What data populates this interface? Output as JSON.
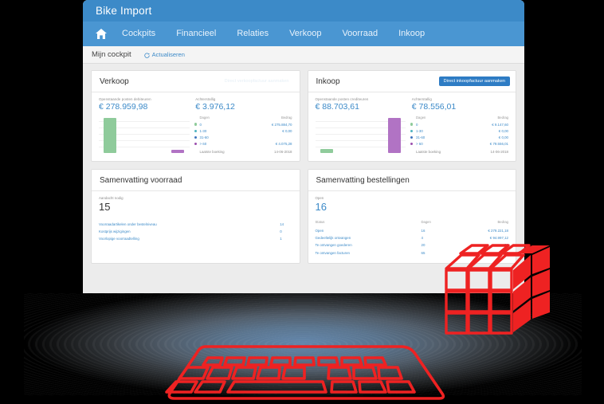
{
  "window": {
    "app_title": "Bike Import",
    "nav": [
      {
        "label": "Cockpits"
      },
      {
        "label": "Financieel"
      },
      {
        "label": "Relaties"
      },
      {
        "label": "Verkoop"
      },
      {
        "label": "Voorraad"
      },
      {
        "label": "Inkoop"
      }
    ],
    "home_icon": "home-icon",
    "subbar": {
      "breadcrumb": "Mijn cockpit",
      "refresh_label": "Actualiseren",
      "refresh_icon": "refresh-icon"
    }
  },
  "colors": {
    "titlebar": "#3c8ac8",
    "navbar": "#4a96d2",
    "accent_blue": "#3c8ac8",
    "button_blue": "#2e7cc4",
    "bar_green": "#8fcb9b",
    "bar_purple": "#b173c4",
    "legend_green": "#8fcb9b",
    "legend_teal": "#4fb3c0",
    "legend_blue": "#3f74bd",
    "legend_purple": "#9b4fae",
    "wireframe_red": "#ee2222"
  },
  "cards": {
    "verkoop": {
      "title": "Verkoop",
      "action_label": "Direct verkoopfactuur aanmaken",
      "kpi_left_label": "Openstaande posten debiteuren",
      "kpi_left_value": "€ 278.959,98",
      "kpi_right_label": "Achterstallig",
      "kpi_right_value": "€ 3.976,12",
      "col_days": "Dagen",
      "col_amount": "Bedrag",
      "rows": [
        {
          "color": "#8fcb9b",
          "days": "0",
          "amount": "€ 275.884,70"
        },
        {
          "color": "#4fb3c0",
          "days": "1-30",
          "amount": "€ 0,00"
        },
        {
          "color": "#3f74bd",
          "days": "31-60",
          "amount": ""
        },
        {
          "color": "#9b4fae",
          "days": "> 60",
          "amount": "€ 4.075,28"
        }
      ],
      "last_label": "Laatste boeking",
      "last_value": "14-06-2018",
      "chart_data": {
        "type": "bar",
        "categories": [
          "0",
          "1-30",
          "31-60",
          "> 60"
        ],
        "values": [
          275884.7,
          0,
          0,
          4075.28
        ],
        "colors": [
          "#8fcb9b",
          "#4fb3c0",
          "#3f74bd",
          "#b173c4"
        ],
        "title": "Verkoop",
        "xlabel": "Dagen",
        "ylabel": "Bedrag",
        "grid": true,
        "legend": "right"
      }
    },
    "inkoop": {
      "title": "Inkoop",
      "action_label": "Direct inkoopfactuur aanmaken",
      "kpi_left_label": "Openstaande posten crediteuren",
      "kpi_left_value": "€ 88.703,61",
      "kpi_right_label": "Achterstallig",
      "kpi_right_value": "€ 78.556,01",
      "col_days": "Dagen",
      "col_amount": "Bedrag",
      "rows": [
        {
          "color": "#8fcb9b",
          "days": "0",
          "amount": "€ 9.147,60"
        },
        {
          "color": "#4fb3c0",
          "days": "1-30",
          "amount": "€ 0,00"
        },
        {
          "color": "#3f74bd",
          "days": "31-60",
          "amount": "€ 0,00"
        },
        {
          "color": "#9b4fae",
          "days": "> 60",
          "amount": "€ 79.556,01"
        }
      ],
      "last_label": "Laatste boeking",
      "last_value": "14-06-2018",
      "chart_data": {
        "type": "bar",
        "categories": [
          "0",
          "1-30",
          "31-60",
          "> 60"
        ],
        "values": [
          9147.6,
          0,
          0,
          79556.01
        ],
        "colors": [
          "#8fcb9b",
          "#4fb3c0",
          "#3f74bd",
          "#b173c4"
        ],
        "title": "Inkoop",
        "xlabel": "Dagen",
        "ylabel": "Bedrag",
        "grid": true,
        "legend": "right"
      }
    },
    "voorraad": {
      "title": "Samenvatting voorraad",
      "summary_label": "Aandacht nodig",
      "summary_value": "15",
      "rows": [
        {
          "label": "Voorraadartikelen onder bestelniveau",
          "value": "14"
        },
        {
          "label": "Kostprijs wijzigingen",
          "value": "0"
        },
        {
          "label": "Voorlopige voorraadtelling",
          "value": "1"
        }
      ]
    },
    "bestellingen": {
      "title": "Samenvatting bestellingen",
      "summary_label": "Open",
      "summary_value": "16",
      "col_status": "Status",
      "col_days": "Dagen",
      "col_amount": "Bedrag",
      "rows": [
        {
          "status": "Open",
          "days": "16",
          "amount": "€ 279.221,18"
        },
        {
          "status": "Gedeeltelijk ontvangen",
          "days": "4",
          "amount": "€ 94.997,12"
        },
        {
          "status": "Te ontvangen goederen",
          "days": "20",
          "amount": "30"
        },
        {
          "status": "Te ontvangen facturen",
          "days": "65",
          "amount": "122"
        }
      ]
    }
  },
  "illustrations": {
    "cube": "rubiks-cube-wireframe",
    "keyboard": "keyboard-wireframe"
  }
}
